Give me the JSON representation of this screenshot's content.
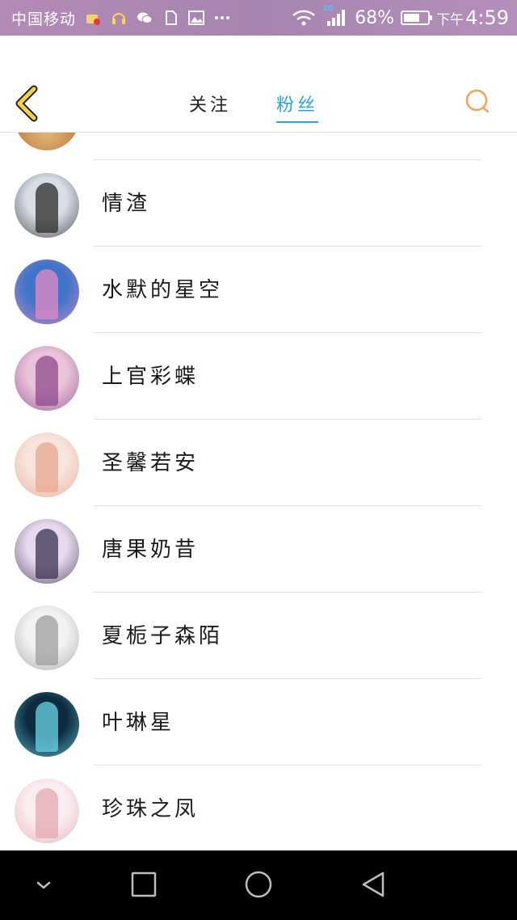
{
  "status_bar": {
    "carrier": "中国移动",
    "network_badge": "2G",
    "battery_percent": "68%",
    "battery_level": 0.68,
    "time_prefix": "下午",
    "time": "4:59",
    "icons": [
      "app-notification-icon",
      "headset-icon",
      "wechat-icon",
      "sim-icon",
      "image-icon",
      "more-icon",
      "wifi-icon",
      "signal-icon",
      "battery-icon"
    ]
  },
  "header": {
    "back_icon": "chevron-left-icon",
    "tabs": [
      {
        "label": "关注",
        "active": false
      },
      {
        "label": "粉丝",
        "active": true
      }
    ],
    "search_icon": "search-icon",
    "accent_color": "#2aa4d4",
    "icon_color": "#f0a35a"
  },
  "fans": [
    {
      "name": "情渣",
      "avatar_colors": [
        "#d9dee6",
        "#2b2b2b"
      ]
    },
    {
      "name": "水默的星空",
      "avatar_colors": [
        "#3f74c8",
        "#e58ac5"
      ]
    },
    {
      "name": "上官彩蝶",
      "avatar_colors": [
        "#e9c3d8",
        "#8e4a8f"
      ]
    },
    {
      "name": "圣馨若安",
      "avatar_colors": [
        "#f7e4dc",
        "#e8a88f"
      ]
    },
    {
      "name": "唐果奶昔",
      "avatar_colors": [
        "#e8d9ee",
        "#3d3350"
      ]
    },
    {
      "name": "夏栀子森陌",
      "avatar_colors": [
        "#f2f2f2",
        "#9e9e9e"
      ]
    },
    {
      "name": "叶琳星",
      "avatar_colors": [
        "#0d2a3e",
        "#6bd6e8"
      ]
    },
    {
      "name": "珍珠之凤",
      "avatar_colors": [
        "#fbeef0",
        "#e4a7b2"
      ]
    }
  ],
  "nav_bar": {
    "icons": [
      "hide-nav-icon",
      "recents-icon",
      "home-icon",
      "back-icon"
    ]
  }
}
